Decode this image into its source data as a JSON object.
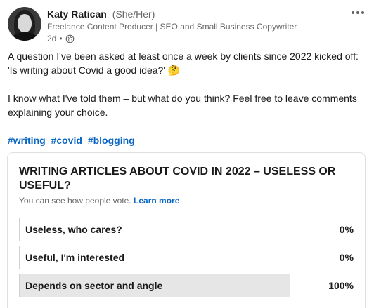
{
  "author": {
    "name": "Katy Ratican",
    "pronouns": "(She/Her)",
    "headline": "Freelance Content Producer | SEO and Small Business Copywriter",
    "time": "2d",
    "separator": "•"
  },
  "post": {
    "paragraph1": "A question I've been asked at least once a week by clients since 2022 kicked off: 'Is writing about Covid a good idea?' 🤔",
    "paragraph2": "I know what I've told them – but what do you think? Feel free to leave comments explaining your choice.",
    "hashtags": [
      "#writing",
      "#covid",
      "#blogging"
    ]
  },
  "poll": {
    "title": "WRITING ARTICLES ABOUT COVID IN 2022 – USELESS OR USEFUL?",
    "note": "You can see how people vote.",
    "learn_more": "Learn more",
    "options": [
      {
        "label": "Useless, who cares?",
        "percent_text": "0%",
        "fraction": 0.0
      },
      {
        "label": "Useful, I'm interested",
        "percent_text": "0%",
        "fraction": 0.0
      },
      {
        "label": "Depends on sector and angle",
        "percent_text": "100%",
        "fraction": 1.0
      }
    ]
  },
  "icons": {
    "more": "more-horizontal-icon",
    "visibility": "globe-icon"
  },
  "colors": {
    "link": "#0a66c2",
    "poll_fill": "#e6e6e6"
  }
}
